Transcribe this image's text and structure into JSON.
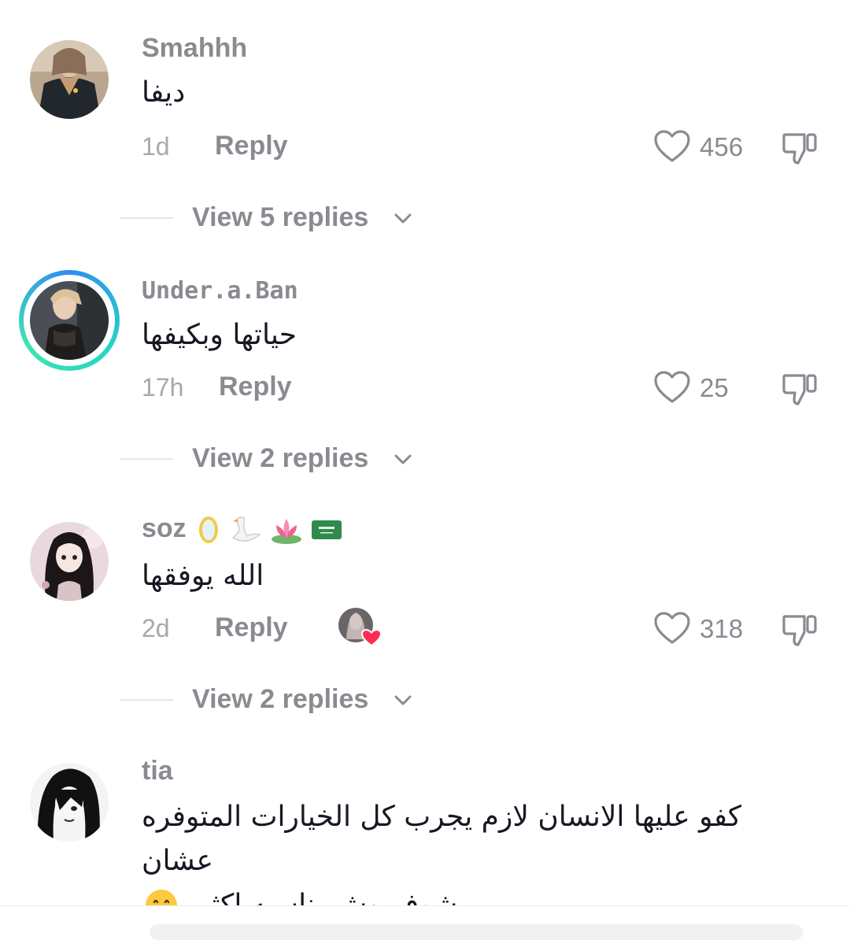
{
  "comments": [
    {
      "username": "Smahhh",
      "text": "ديفا",
      "time": "1d",
      "reply_label": "Reply",
      "like_count": "456",
      "view_replies": "View 5 replies"
    },
    {
      "username": "Under.a.Ban",
      "text": "حياتها وبكيفها",
      "time": "17h",
      "reply_label": "Reply",
      "like_count": "25",
      "view_replies": "View 2 replies"
    },
    {
      "username": "soz",
      "username_emojis": [
        "mirror",
        "swan",
        "lotus",
        "saudi-flag"
      ],
      "text": "الله يوفقها",
      "time": "2d",
      "reply_label": "Reply",
      "like_count": "318",
      "liked_by_creator": true,
      "view_replies": "View 2 replies"
    },
    {
      "username": "tia",
      "text_line1": "كفو عليها الانسان لازم يجرب كل الخيارات المتوفره عشان",
      "text_line2": "يشوف وش يناسبه اكثر",
      "text_emoji": "hugging-face"
    }
  ],
  "colors": {
    "muted_text": "#8a8b91",
    "body_text": "#161823",
    "creator_heart": "#fe2c55",
    "story_ring_start": "#2f8df0",
    "story_ring_end": "#3fe3b0"
  }
}
